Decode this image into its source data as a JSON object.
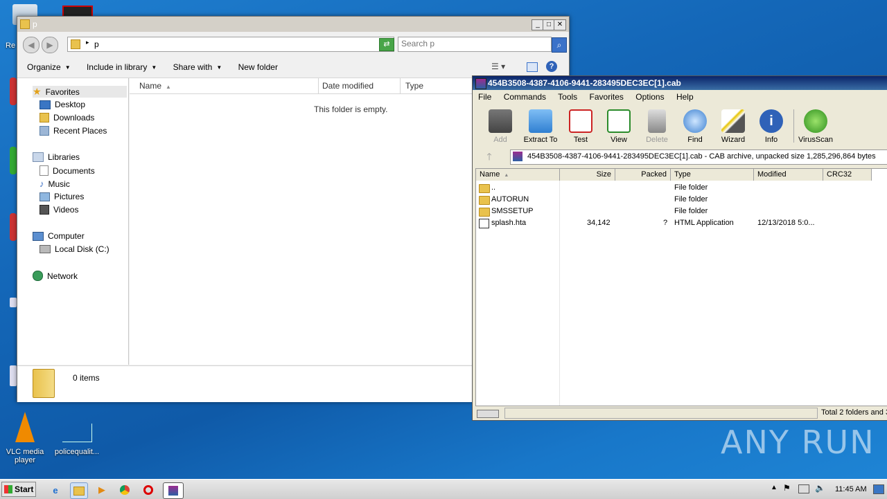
{
  "desktop": {
    "icons": [
      {
        "label": "VLC media player"
      },
      {
        "label": "policequalit..."
      }
    ],
    "watermark": "ANY RUN"
  },
  "explorer": {
    "title": "p",
    "address": "p",
    "search_placeholder": "Search p",
    "commands": {
      "organize": "Organize",
      "include": "Include in library",
      "share": "Share with",
      "new_folder": "New folder"
    },
    "nav": {
      "favorites": "Favorites",
      "desktop": "Desktop",
      "downloads": "Downloads",
      "recent": "Recent Places",
      "libraries": "Libraries",
      "documents": "Documents",
      "music": "Music",
      "pictures": "Pictures",
      "videos": "Videos",
      "computer": "Computer",
      "local_disk": "Local Disk (C:)",
      "network": "Network"
    },
    "columns": {
      "name": "Name",
      "date": "Date modified",
      "type": "Type"
    },
    "empty_message": "This folder is empty.",
    "status": "0 items"
  },
  "winrar": {
    "title": "454B3508-4387-4106-9441-283495DEC3EC[1].cab",
    "menu": [
      "File",
      "Commands",
      "Tools",
      "Favorites",
      "Options",
      "Help"
    ],
    "tools": [
      {
        "label": "Add",
        "icon": "add-archive-icon",
        "disabled": true
      },
      {
        "label": "Extract To",
        "icon": "extract-folder-icon",
        "disabled": false
      },
      {
        "label": "Test",
        "icon": "test-checklist-icon",
        "disabled": false
      },
      {
        "label": "View",
        "icon": "view-book-icon",
        "disabled": false
      },
      {
        "label": "Delete",
        "icon": "trash-icon",
        "disabled": true
      },
      {
        "label": "Find",
        "icon": "magnifier-icon",
        "disabled": false
      },
      {
        "label": "Wizard",
        "icon": "wand-icon",
        "disabled": false
      },
      {
        "label": "Info",
        "icon": "info-icon",
        "disabled": false
      },
      {
        "label": "VirusScan",
        "icon": "virus-scan-icon",
        "disabled": false
      }
    ],
    "path_info": "454B3508-4387-4106-9441-283495DEC3EC[1].cab - CAB archive, unpacked size 1,285,296,864 bytes",
    "columns": {
      "name": "Name",
      "size": "Size",
      "packed": "Packed",
      "type": "Type",
      "modified": "Modified",
      "crc": "CRC32"
    },
    "rows": [
      {
        "name": "..",
        "size": "",
        "packed": "",
        "type": "File folder",
        "modified": "",
        "kind": "folder"
      },
      {
        "name": "AUTORUN",
        "size": "",
        "packed": "",
        "type": "File folder",
        "modified": "",
        "kind": "folder"
      },
      {
        "name": "SMSSETUP",
        "size": "",
        "packed": "",
        "type": "File folder",
        "modified": "",
        "kind": "folder"
      },
      {
        "name": "splash.hta",
        "size": "34,142",
        "packed": "?",
        "type": "HTML Application",
        "modified": "12/13/2018 5:0...",
        "kind": "file"
      }
    ],
    "status": "Total 2 folders and 3"
  },
  "taskbar": {
    "start": "Start",
    "clock": "11:45 AM"
  }
}
